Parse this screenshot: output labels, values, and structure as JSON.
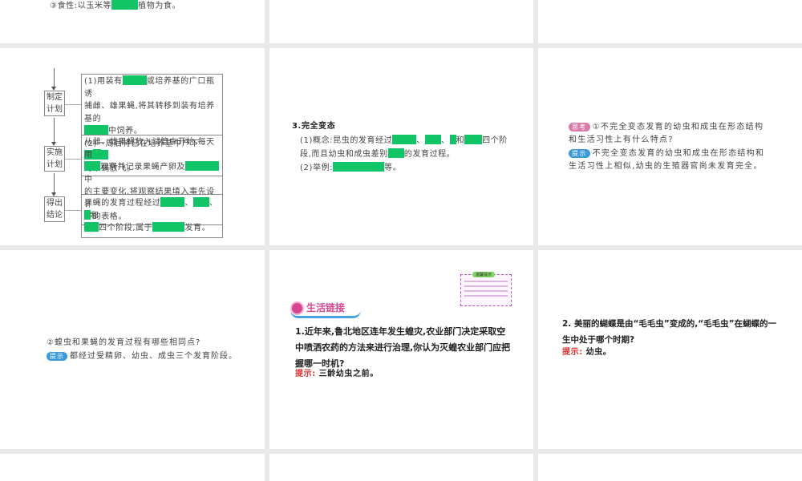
{
  "slide_top_left": {
    "line_pre": "③食性:以玉米等",
    "line_post": "植物为食。"
  },
  "slide_flow": {
    "labels": [
      [
        "制定",
        "计划"
      ],
      [
        "实施",
        "计划"
      ],
      [
        "得出",
        "结论"
      ]
    ],
    "plan": {
      "a1": "(1)用装有",
      "a2": "或培养基的广口瓶诱",
      "a3": "捕雌、雄果蝇,将其转移到装有培养基的",
      "a4": "中饲养。",
      "a5": "(2)一周后将已在培养基中产下",
      "a6": "的果蝇放飞。"
    },
    "do": {
      "b1": "从雌、雄果蝇放入试管中开始,每天用",
      "b2": "观察并记录果蝇产卵及",
      "b3": "中",
      "b4": "的主要变化,将观察结果填入事先设计",
      "b5": "好的表格。"
    },
    "result": {
      "c1": "果蝇的发育过程经过",
      "sep": "、",
      "and": "和",
      "c2": "四个阶段,属于",
      "c3": "发育。"
    }
  },
  "slide_complete": {
    "title": "3.完全变态",
    "p1": "(1)概念:昆虫的发育经过",
    "sep": "、",
    "and": "和",
    "p1b": "四个阶",
    "p2": "段,而且幼虫和成虫差别",
    "p2b": "的发育过程。",
    "p3": "(2)举例:",
    "p3b": "等。"
  },
  "slide_think": {
    "badge_think": "思考",
    "q": "①不完全变态发育的幼虫和成虫在形态结构和生活习性上有什么特点?",
    "badge_hint": "提示",
    "a": "不完全变态发育的幼虫和成虫在形态结构和生活习性上相似,幼虫的生殖器官尚未发育完全。"
  },
  "slide_q2": {
    "q": "②蝗虫和果蝇的发育过程有哪些相同点?",
    "badge_hint": "提示",
    "a": "都经过受精卵、幼虫、成虫三个发育阶段。"
  },
  "slide_life": {
    "note_title": "温馨提示",
    "banner": "生活链接",
    "q": "1.近年来,鲁北地区连年发生蝗灾,农业部门决定采取空中喷洒农药的方法来进行治理,你认为灭蝗农业部门应把握哪一时机?",
    "hint_label": "提示:",
    "hint": "三龄幼虫之前。"
  },
  "slide_butterfly": {
    "q": "2. 美丽的蝴蝶是由“毛毛虫”变成的,“毛毛虫”在蝴蝶的一生中处于哪个时期?",
    "hint_label": "提示:",
    "hint": "幼虫。"
  },
  "colors": {
    "blank": "#11c466",
    "gap": "#e9e9e9",
    "hint": "#e03030"
  }
}
